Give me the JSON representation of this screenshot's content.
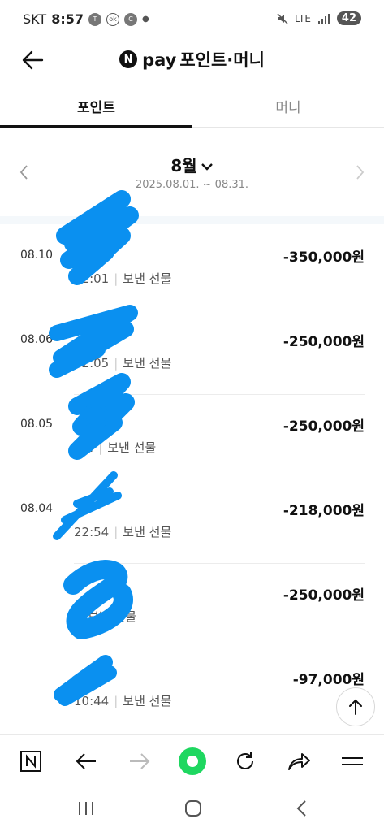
{
  "status_bar": {
    "carrier": "SKT",
    "time": "8:57",
    "icons_left": [
      "talk-icon",
      "ok-icon",
      "c-icon",
      "dot-icon"
    ],
    "network": "LTE",
    "battery": "42"
  },
  "header": {
    "brand_badge": "N",
    "brand": "pay",
    "title": "포인트·머니"
  },
  "tabs": [
    {
      "label": "포인트",
      "active": true
    },
    {
      "label": "머니",
      "active": false
    }
  ],
  "month": {
    "label": "8월",
    "period": "2025.08.01. ~ 08.31."
  },
  "transactions": [
    {
      "date": "08.10",
      "time": "22:01",
      "kind": "보낸 선물",
      "amount": "-350,000원"
    },
    {
      "date": "08.06",
      "time": "22:05",
      "kind": "보낸 선물",
      "amount": "-250,000원"
    },
    {
      "date": "08.05",
      "time": "22:",
      "kind": "보낸 선물",
      "amount": "-250,000원"
    },
    {
      "date": "08.04",
      "time": "22:54",
      "kind": "보낸 선물",
      "amount": "-218,000원"
    },
    {
      "date": "",
      "time": "",
      "kind": "보낸 선물",
      "amount": "-250,000원"
    },
    {
      "date": "",
      "time": "10:44",
      "kind": "보낸 선물",
      "amount": "-97,000원"
    }
  ],
  "colors": {
    "redaction": "#0a90f0",
    "active_tab": "#111111",
    "inactive_tab": "#888888",
    "browser_home": "#1ed760"
  }
}
